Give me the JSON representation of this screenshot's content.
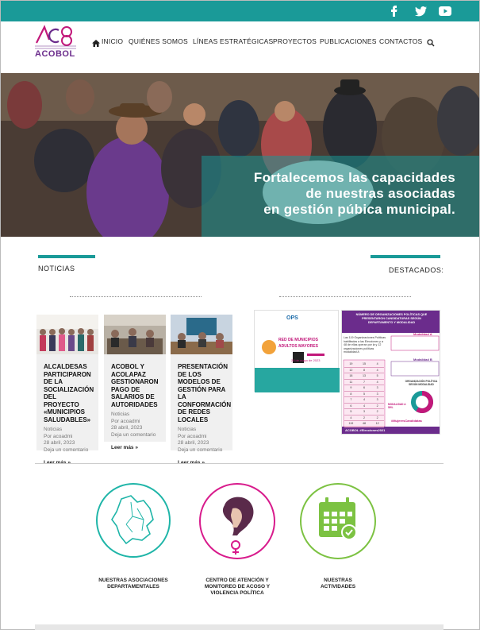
{
  "header": {
    "logo_text": "ACOBOL",
    "social": [
      "f",
      "twitter",
      "youtube"
    ],
    "nav": [
      {
        "label": "INICIO"
      },
      {
        "label": "QUIÉNES SOMOS"
      },
      {
        "label": "LÍNEAS ESTRATÉGICAS"
      },
      {
        "label": "PROYECTOS"
      },
      {
        "label": "PUBLICACIONES"
      },
      {
        "label": "CONTACTOS"
      }
    ]
  },
  "hero": {
    "line1": "Fortalecemos las capacidades",
    "line2": "de nuestras asociadas",
    "line3": "en gestión púbica municipal."
  },
  "sections": {
    "news_title": "NOTICIAS",
    "featured_title": "DESTACADOS:"
  },
  "news": [
    {
      "title": "ALCALDESAS PARTICIPARON DE LA SOCIALIZACIÓN DEL PROYECTO «MUNICIPIOS SALUDABLES»",
      "meta": [
        "Noticias",
        "Por acoadmi",
        "28 abril, 2023",
        "Deja un comentario"
      ],
      "more": "Leer más »"
    },
    {
      "title": "ACOBOL Y ACOLAPAZ GESTIONARON PAGO DE SALARIOS DE AUTORIDADES",
      "meta": [
        "Noticias",
        "Por acoadmi",
        "28 abril, 2023",
        "Deja un comentario"
      ],
      "more": "Leer más »"
    },
    {
      "title": "PRESENTACIÓN DE LOS MODELOS DE GESTIÓN PARA LA CONFORMACIÓN DE REDES LOCALES",
      "meta": [
        "Noticias",
        "Por acoadmi",
        "28 abril, 2023",
        "Deja un comentario"
      ],
      "more": "Leer más »"
    }
  ],
  "featured": {
    "poster1": {
      "brand": "OPS",
      "headline": "RED DE MUNICIPIOS",
      "sub": "ADULTOS MAYORES",
      "date": "26 de mayo de 2023"
    },
    "poster2": {
      "title": "NÚMERO DE ORGANIZACIONES POLÍTICAS QUE PRESENTARON CANDIDATURAS SEGÚN DEPARTAMENTO Y MODALIDAD",
      "body": "Las 119 Organizaciones Políticas habilitadas a las Elecciones y a 48 de ellas operan por la y 12 organizaciones políticas modalidad A",
      "modality_a": "Modalidad A",
      "modality_b": "Modalidad B",
      "donut_label": "ORGANIZACIÓN POLÍTICA SEGÚN MODALIDAD",
      "pct_a": "MODALIDAD A 59%",
      "hashtag": "#MujeresCandidatas",
      "footer": "ACOBOL #Elecciones2021",
      "table_rows": [
        [
          "19",
          "15",
          "4"
        ],
        [
          "12",
          "8",
          "4"
        ],
        [
          "18",
          "13",
          "5"
        ],
        [
          "11",
          "7",
          "4"
        ],
        [
          "9",
          "6",
          "3"
        ],
        [
          "8",
          "5",
          "3"
        ],
        [
          "7",
          "4",
          "3"
        ],
        [
          "6",
          "4",
          "2"
        ],
        [
          "5",
          "3",
          "2"
        ],
        [
          "4",
          "2",
          "2"
        ],
        [
          "119",
          "48",
          "12"
        ]
      ],
      "donut_pct": 0.59
    }
  },
  "services": [
    {
      "label": "NUESTRAS ASOCIACIONES DEPARTAMENTALES",
      "color": "#1fb5a8"
    },
    {
      "label": "CENTRO DE ATENCIÓN Y MONITOREO DE ACOSO Y VIOLENCIA POLÍTICA",
      "color": "#d81b8c"
    },
    {
      "label": "NUESTRAS ACTIVIDADES",
      "color": "#7cc242"
    }
  ],
  "colors": {
    "teal": "#1a9a98",
    "magenta": "#c2187a",
    "purple": "#6b2c8c",
    "green": "#7cc242"
  }
}
